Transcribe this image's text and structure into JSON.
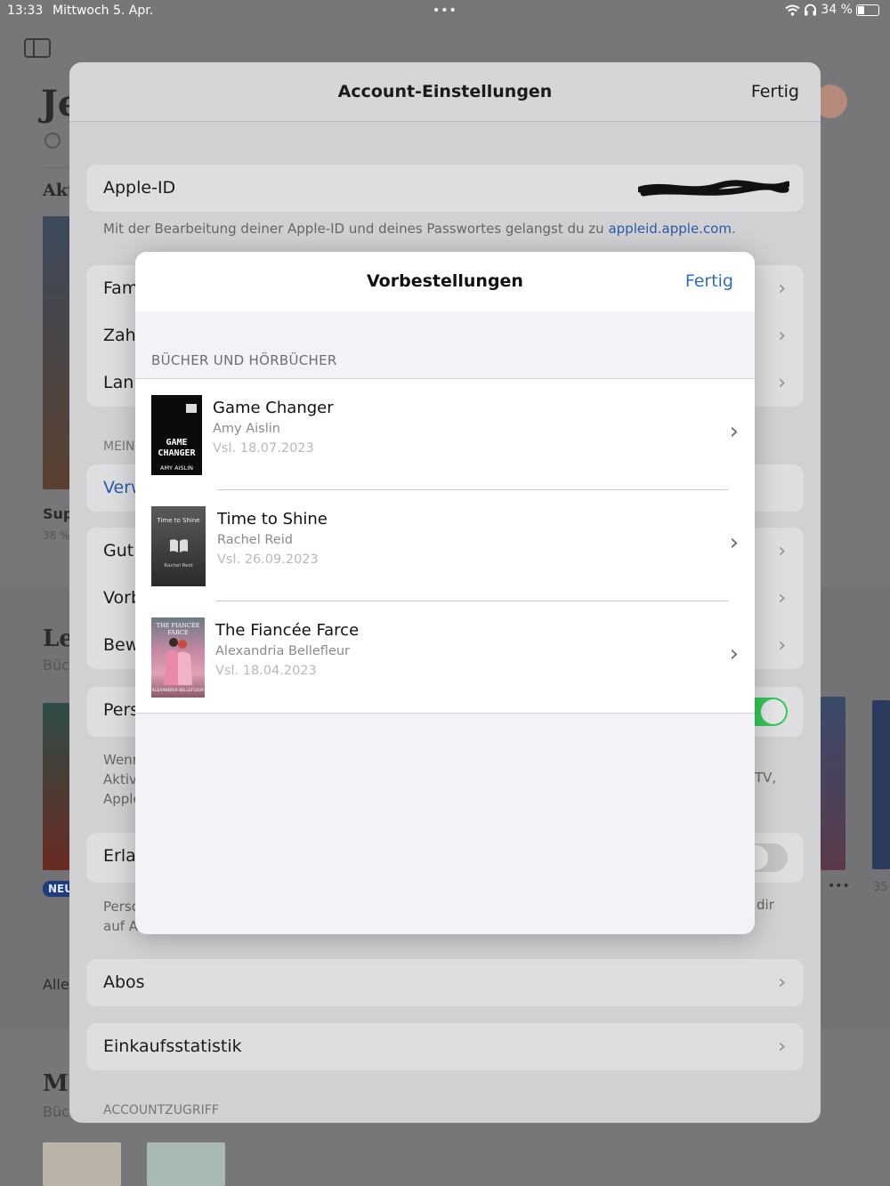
{
  "status_bar": {
    "time": "13:33",
    "date": "Mittwoch 5. Apr.",
    "battery": "34 %",
    "battery_level": 0.34
  },
  "background_app": {
    "header_partial": "Je",
    "section_partial_1": "Akt",
    "book_title_partial": "Sup",
    "book_progress_partial": "38 %",
    "section_partial_2": "Le",
    "subtitle_partial_2": "Büc",
    "badge_new": "NEU",
    "all_partial": "Alle",
    "section_partial_3": "Mo",
    "subtitle_partial_3": "Büc",
    "more_dots": "•••",
    "count_partial": "35"
  },
  "account_sheet": {
    "title": "Account-Einstellungen",
    "done_label": "Fertig",
    "apple_id_label": "Apple-ID",
    "apple_id_footnote": "Mit der Bearbeitung deiner Apple-ID und deines Passwortes gelangst du zu ",
    "apple_id_link": "appleid.apple.com",
    "apple_id_footnote_end": ".",
    "group1": [
      "Fam",
      "Zah",
      "Lan"
    ],
    "section_mein": "MEIN",
    "manage_partial": "Verw",
    "group2": [
      "Gutl",
      "Vorb",
      "Bew"
    ],
    "personalize_partial": "Pers",
    "personalize_note_lines": [
      "Wenn",
      "Aktiv",
      "Apple"
    ],
    "personalize_note_right": "TV,",
    "allow_partial": "Erla",
    "allow_note_lines": [
      "Perso",
      "auf A"
    ],
    "allow_note_right": "dir",
    "subscriptions": "Abos",
    "purchase_stats": "Einkaufsstatistik",
    "section_account_access": "ACCOUNTZUGRIFF"
  },
  "modal": {
    "title": "Vorbestellungen",
    "done_label": "Fertig",
    "section_header": "BÜCHER UND HÖRBÜCHER",
    "items": [
      {
        "title": "Game Changer",
        "author": "Amy Aislin",
        "date": "Vsl. 18.07.2023",
        "cover_title": "GAME CHANGER",
        "cover_author": "AMY AISLIN"
      },
      {
        "title": "Time to Shine",
        "author": "Rachel Reid",
        "date": "Vsl. 26.09.2023",
        "cover_title": "Time to Shine",
        "cover_author": "Rachel Reid"
      },
      {
        "title": "The Fiancée Farce",
        "author": "Alexandria Bellefleur",
        "date": "Vsl. 18.04.2023",
        "cover_title": "THE FIANCÉE FARCE",
        "cover_author": "ALEXANDRIA BELLEFLEUR"
      }
    ]
  },
  "colors": {
    "accent": "#2f6ec0",
    "toggle_on": "#34c759",
    "overlay": "#777779"
  }
}
